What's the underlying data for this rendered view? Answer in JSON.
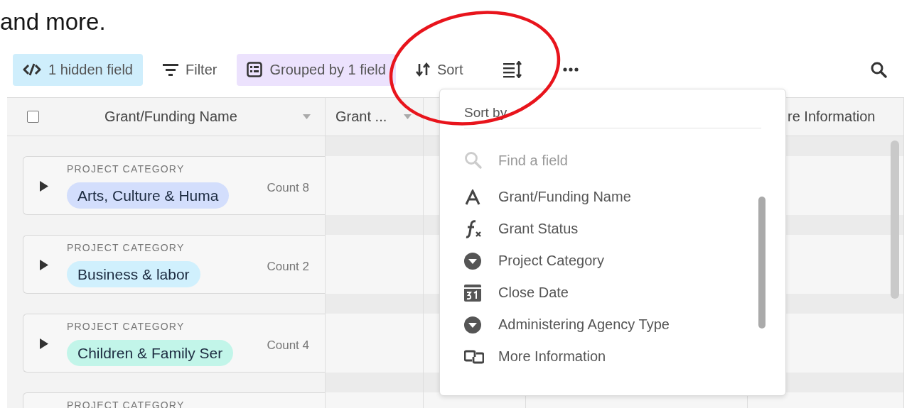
{
  "caption": "and more.",
  "toolbar": {
    "items": [
      {
        "kind": "hidden",
        "label": "1 hidden field"
      },
      {
        "kind": "filter",
        "label": "Filter"
      },
      {
        "kind": "group",
        "label": "Grouped by 1 field"
      },
      {
        "kind": "sort",
        "label": "Sort"
      },
      {
        "kind": "row_height"
      },
      {
        "kind": "more"
      }
    ]
  },
  "table": {
    "header": {
      "checked": false
    },
    "columns": [
      {
        "name": "Grant/Funding Name"
      },
      {
        "name": "Grant ..."
      },
      {
        "name": "re Information"
      }
    ],
    "groups": [
      {
        "field": "PROJECT CATEGORY",
        "value": "Arts, Culture & Huma",
        "color": "#d3defc",
        "count": "Count 8",
        "expanded": false
      },
      {
        "field": "PROJECT CATEGORY",
        "value": "Business & labor",
        "color": "#d0f0fd",
        "count": "Count 2",
        "expanded": false
      },
      {
        "field": "PROJECT CATEGORY",
        "value": "Children & Family Ser",
        "color": "#c2f5e9",
        "count": "Count 4",
        "expanded": false
      },
      {
        "field": "PROJECT CATEGORY"
      }
    ]
  },
  "sort_menu": {
    "title": "Sort by",
    "search": {
      "placeholder": "Find a field"
    },
    "fields": [
      {
        "kind": "text",
        "name": "Grant/Funding Name"
      },
      {
        "kind": "formula",
        "name": "Grant Status"
      },
      {
        "kind": "select",
        "name": "Project Category"
      },
      {
        "kind": "date",
        "name": "Close Date"
      },
      {
        "kind": "select",
        "name": "Administering Agency Type"
      },
      {
        "kind": "link",
        "name": "More Information"
      }
    ]
  },
  "annotation": {
    "kind": "circle"
  }
}
